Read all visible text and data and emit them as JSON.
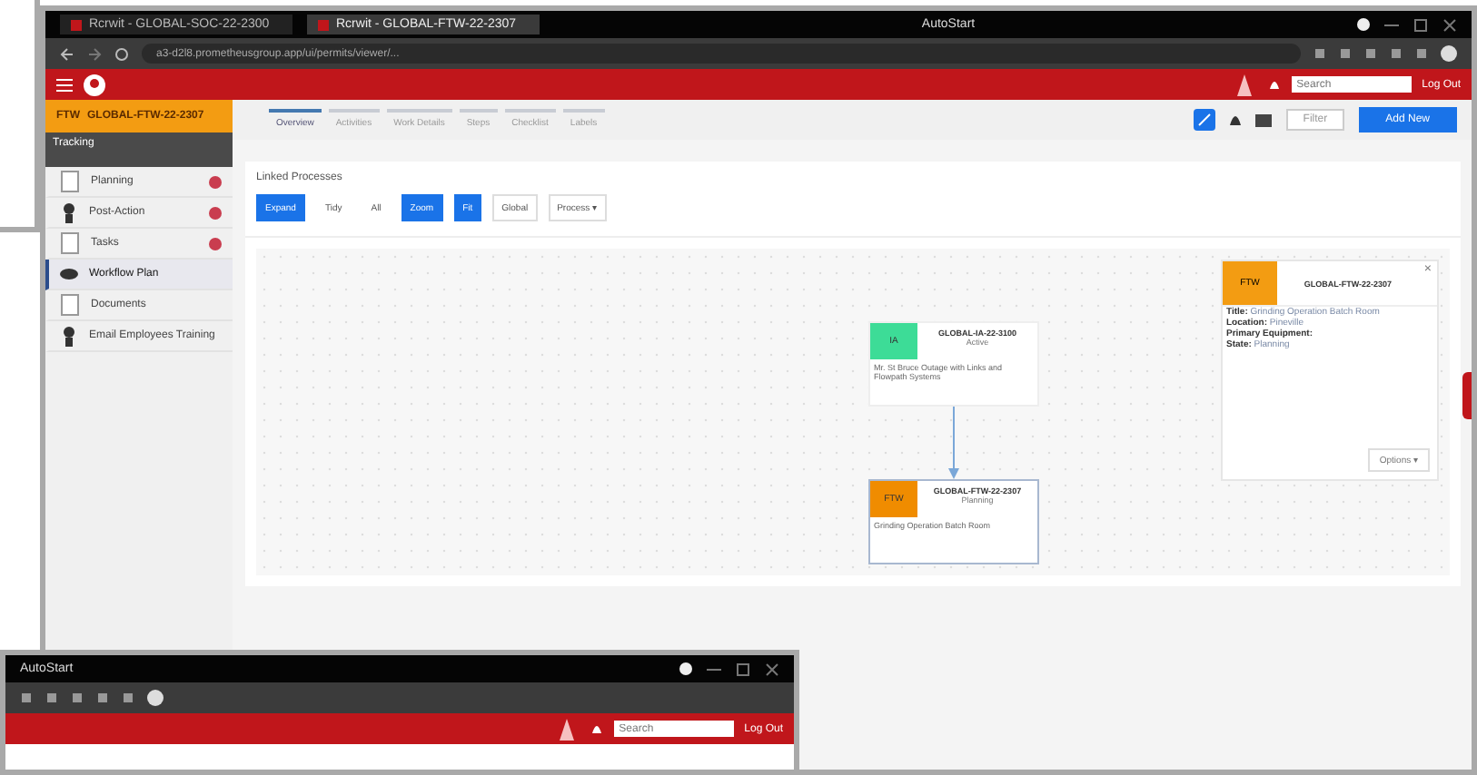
{
  "browser_tabs": [
    {
      "label": "Rcrwit - GLOBAL-SOC-22-2300",
      "selected": false
    },
    {
      "label": "Rcrwit - GLOBAL-FTW-22-2307",
      "selected": true
    }
  ],
  "window": {
    "title": "AutoStart"
  },
  "address_bar": {
    "url": "a3-d2l8.prometheusgroup.app/ui/permits/viewer/..."
  },
  "app_bar": {
    "search": {
      "placeholder": "Search"
    },
    "sign_out": "Log Out"
  },
  "sidebar": {
    "header": {
      "badge": "FTW",
      "title": "GLOBAL-FTW-22-2307"
    },
    "section": "Tracking",
    "items": [
      {
        "label": "Planning",
        "kind": "doc",
        "badge": true,
        "selected": false
      },
      {
        "label": "Post-Action",
        "kind": "person",
        "badge": true,
        "selected": false
      },
      {
        "label": "Tasks",
        "kind": "doc",
        "badge": true,
        "selected": false
      },
      {
        "label": "Workflow Plan",
        "kind": "eye",
        "badge": false,
        "selected": true
      },
      {
        "label": "Documents",
        "kind": "doc",
        "badge": false,
        "selected": false
      },
      {
        "label": "Email Employees Training",
        "kind": "person",
        "badge": false,
        "selected": false
      }
    ]
  },
  "page_tabs": [
    {
      "label": "Overview",
      "selected": true
    },
    {
      "label": "Activities",
      "selected": false
    },
    {
      "label": "Work Details",
      "selected": false
    },
    {
      "label": "Steps",
      "selected": false
    },
    {
      "label": "Checklist",
      "selected": false
    },
    {
      "label": "Labels",
      "selected": false
    }
  ],
  "toolbar": {
    "options": "Filter",
    "primary": "Add New"
  },
  "linked_processes": {
    "title": "Linked Processes",
    "buttons": [
      {
        "label": "Expand",
        "kind": "primary"
      },
      {
        "label": "Tidy",
        "kind": "plain"
      },
      {
        "label": "All",
        "kind": "plain"
      },
      {
        "label": "Zoom",
        "kind": "primary"
      },
      {
        "label": "Fit",
        "kind": "primary"
      },
      {
        "label": "Global",
        "kind": "outline"
      },
      {
        "label": "Process ▾",
        "kind": "outline"
      }
    ],
    "nodes": [
      {
        "badge": "IA",
        "color": "#3ddc97",
        "title": "GLOBAL-IA-22-3100",
        "state": "Active",
        "description": "Mr. St Bruce Outage with Links and Flowpath Systems"
      },
      {
        "badge": "FTW",
        "color": "#f08c00",
        "title": "GLOBAL-FTW-22-2307",
        "state": "Planning",
        "description": "Grinding Operation Batch Room"
      }
    ],
    "detail": {
      "badge": "FTW",
      "title": "GLOBAL-FTW-22-2307",
      "close": "×",
      "fields": [
        {
          "label": "Title:",
          "value": "Grinding Operation Batch Room"
        },
        {
          "label": "Location:",
          "value": "Pineville"
        },
        {
          "label": "Primary Equipment:"
        },
        {
          "label": "State:",
          "value": "Planning"
        }
      ],
      "action": "Options ▾"
    }
  },
  "back_window": {
    "title": "AutoStart",
    "search": {
      "placeholder": "Search"
    },
    "sign_out": "Log Out"
  }
}
